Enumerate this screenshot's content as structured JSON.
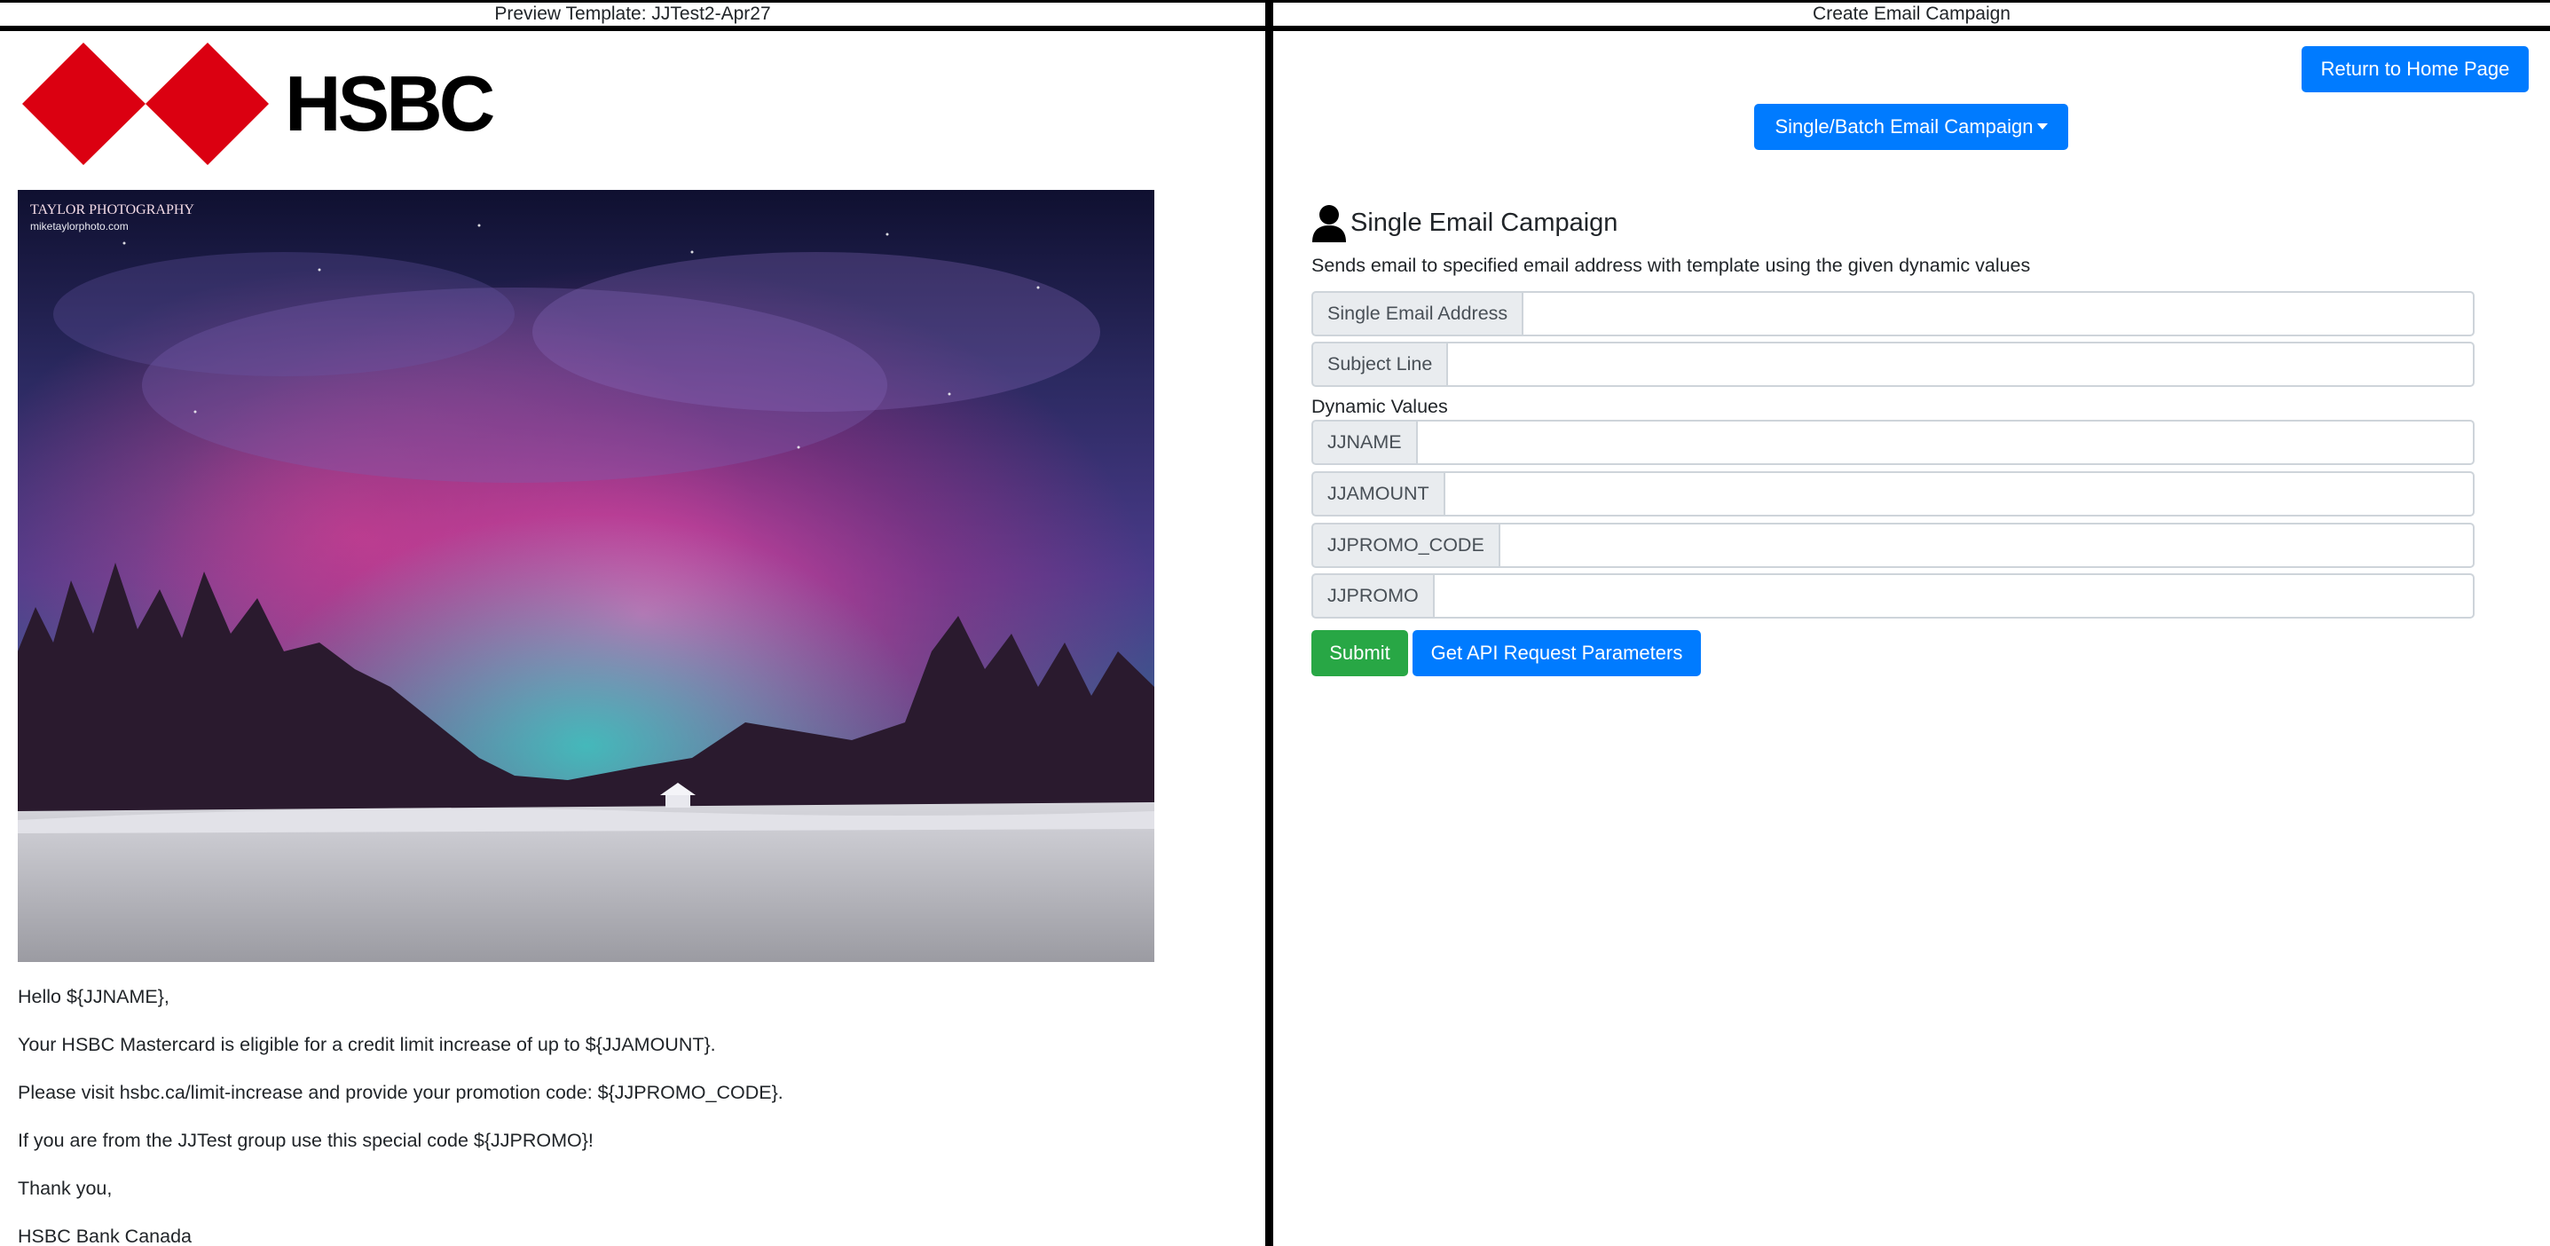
{
  "preview": {
    "title": "Preview Template: JJTest2-Apr27",
    "logo_text": "HSBC",
    "watermark_line1": "TAYLOR PHOTOGRAPHY",
    "watermark_line2": "miketaylorphoto.com",
    "lines": [
      "Hello ${JJNAME},",
      "Your HSBC Mastercard is eligible for a credit limit increase of up to ${JJAMOUNT}.",
      "Please visit hsbc.ca/limit-increase and provide your promotion code: ${JJPROMO_CODE}.",
      "If you are from the JJTest group use this special code ${JJPROMO}!",
      "Thank you,",
      "HSBC Bank Canada"
    ]
  },
  "campaign": {
    "title": "Create Email Campaign",
    "home_button": "Return to Home Page",
    "mode_dropdown": "Single/Batch Email Campaign",
    "section_title": "Single Email Campaign",
    "section_icon": "person-icon",
    "description": "Sends email to specified email address with template using the given dynamic values",
    "fields": {
      "email_label": "Single Email Address",
      "email_value": "",
      "subject_label": "Subject Line",
      "subject_value": ""
    },
    "dynamic_values_label": "Dynamic Values",
    "dynamic": {
      "jjname_label": "JJNAME",
      "jjamount_label": "JJAMOUNT",
      "jjpromo_code_label": "JJPROMO_CODE",
      "jjpromo_label": "JJPROMO"
    },
    "submit_button": "Submit",
    "api_button": "Get API Request Parameters"
  },
  "colors": {
    "primary": "#007bff",
    "success": "#28a745",
    "hsbc_red": "#db0011"
  }
}
